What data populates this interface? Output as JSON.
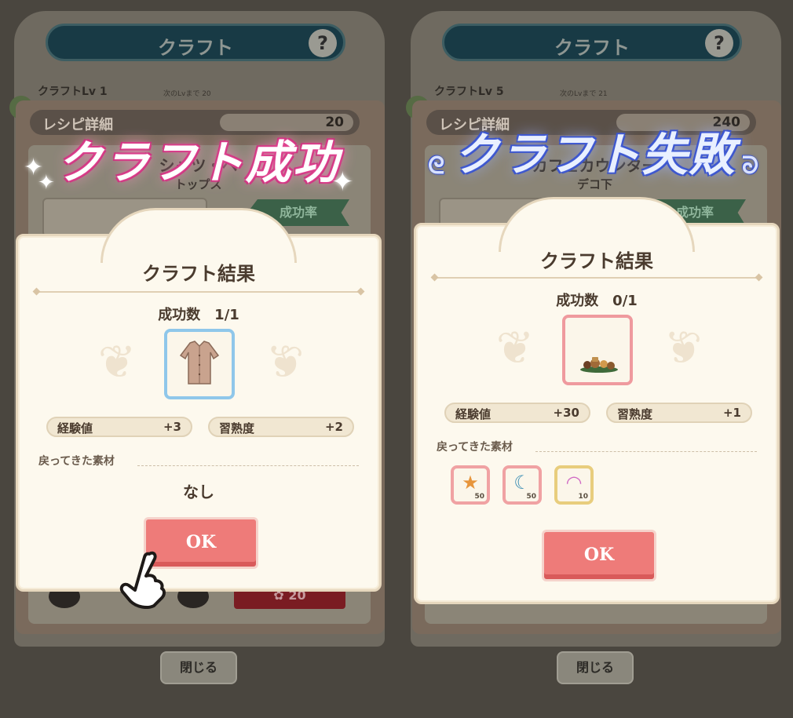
{
  "window": {
    "title": "クラフト",
    "help_icon": "?",
    "close_label": "閉じる"
  },
  "left": {
    "craft_lv_label": "クラフトLv",
    "craft_lv_value": "1",
    "craft_lv_next": "次のLvまで 20",
    "recipe_label": "レシピ詳細",
    "recipe_cost": "20",
    "item_name": "シャツ・ベ",
    "item_category": "トップス",
    "success_rate_label": "成功率",
    "cost_button": "20",
    "headline": "クラフト成功",
    "dialog": {
      "title": "クラフト結果",
      "success_count": "成功数　1/1",
      "exp_label": "経験値",
      "exp_value": "+3",
      "mastery_label": "習熟度",
      "mastery_value": "+2",
      "returned_label": "戻ってきた素材",
      "returned_none": "なし",
      "ok_label": "OK"
    }
  },
  "right": {
    "craft_lv_label": "クラフトLv",
    "craft_lv_value": "5",
    "craft_lv_next": "次のLvまで 21",
    "recipe_label": "レシピ詳細",
    "recipe_cost": "240",
    "item_name": "カフェカウンター",
    "item_category": "デコ下",
    "success_rate_label": "成功率",
    "headline": "クラフト失敗",
    "dialog": {
      "title": "クラフト結果",
      "success_count": "成功数　0/1",
      "exp_label": "経験値",
      "exp_value": "+30",
      "mastery_label": "習熟度",
      "mastery_value": "+1",
      "returned_label": "戻ってきた素材",
      "materials": [
        {
          "icon": "star-icon",
          "glyph": "★",
          "qty": "50"
        },
        {
          "icon": "moon-icon",
          "glyph": "☾",
          "qty": "50"
        },
        {
          "icon": "rainbow-icon",
          "glyph": "◠",
          "qty": "10"
        }
      ],
      "ok_label": "OK"
    }
  },
  "colors": {
    "ok_button": "#ee7b79",
    "success_glow": "#e8509a",
    "fail_glow": "#3b53c9",
    "dialog_bg": "#fdf9ee"
  }
}
